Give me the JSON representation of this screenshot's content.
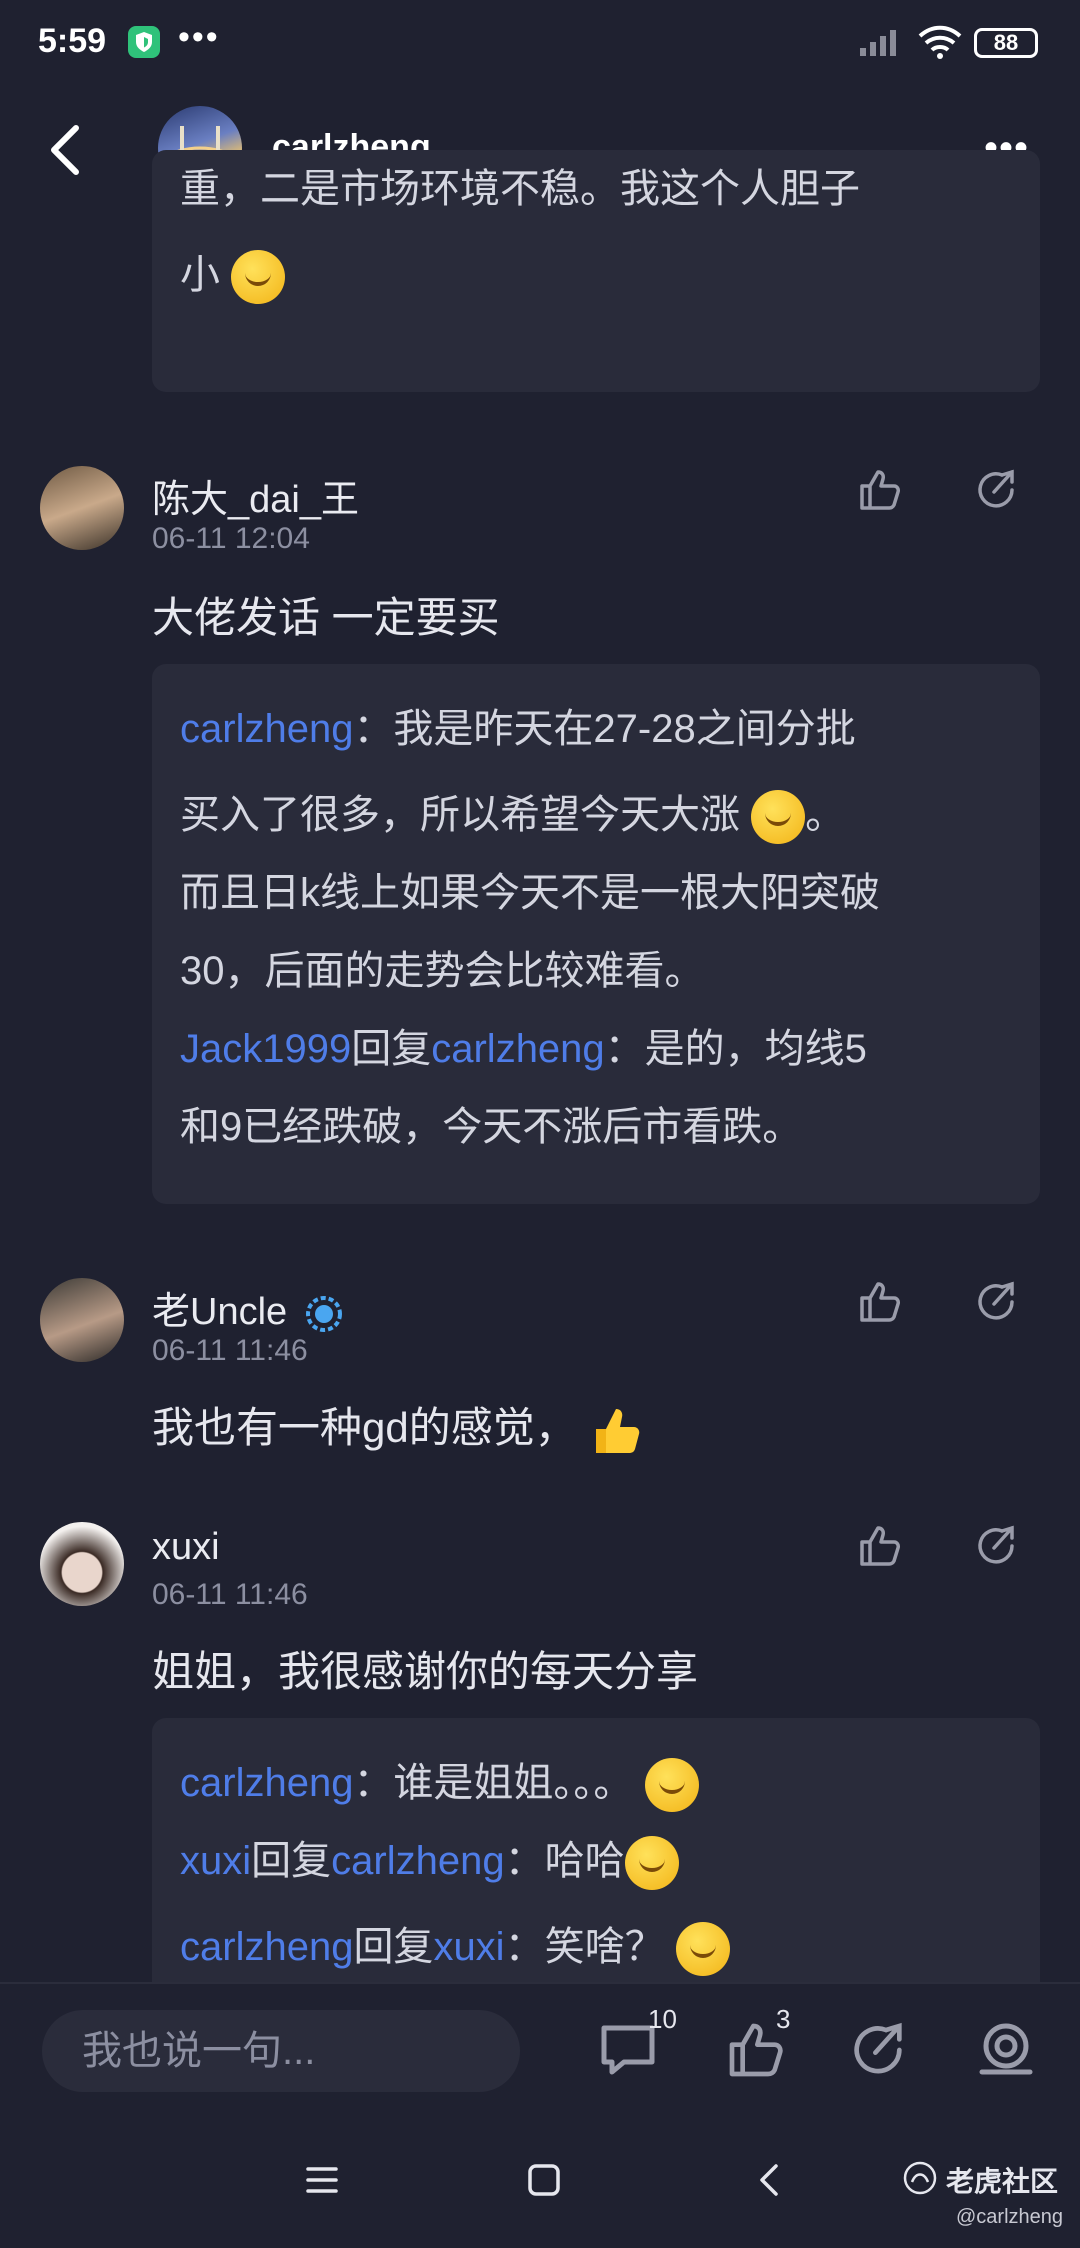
{
  "status_bar": {
    "time": "5:59",
    "battery": "88"
  },
  "header": {
    "name": "carlzheng"
  },
  "top_quote": {
    "line1": "重，二是市场环境不稳。我这个人胆子",
    "line2": "小"
  },
  "comments": [
    {
      "user": "陈大_dai_王",
      "date": "06-11 12:04",
      "text": "大佬发话  一定要买",
      "quote": {
        "l1_name": "carlzheng",
        "l1_text": "：我是昨天在27-28之间分批",
        "l2": "买入了很多，所以希望今天大涨",
        "l2_end": "。",
        "l3": "而且日k线上如果今天不是一根大阳突破",
        "l4": "30，后面的走势会比较难看。",
        "l5_name1": "Jack1999",
        "l5_reply": "回复",
        "l5_name2": "carlzheng",
        "l5_text": "：是的，均线5",
        "l6": "和9已经跌破，今天不涨后市看跌。"
      }
    },
    {
      "user": "老Uncle",
      "date": "06-11 11:46",
      "text": "我也有一种gd的感觉，"
    },
    {
      "user": "xuxi",
      "date": "06-11 11:46",
      "text": "姐姐，我很感谢你的每天分享",
      "quote": {
        "l1_name": "carlzheng",
        "l1_text": "：谁是姐姐。。。",
        "l2_name1": "xuxi",
        "l2_reply": "回复",
        "l2_name2": "carlzheng",
        "l2_text": "：哈哈",
        "l3_name1": "carlzheng",
        "l3_reply": "回复",
        "l3_name2": "xuxi",
        "l3_text": "：笑啥？"
      }
    }
  ],
  "bottom_bar": {
    "placeholder": "我也说一句...",
    "comment_count": "10",
    "like_count": "3"
  },
  "watermark": {
    "brand": "老虎社区",
    "handle": "@carlzheng"
  },
  "colors": {
    "background": "#1f2130",
    "quote_bg": "#292b3a",
    "link": "#4f7de8"
  }
}
